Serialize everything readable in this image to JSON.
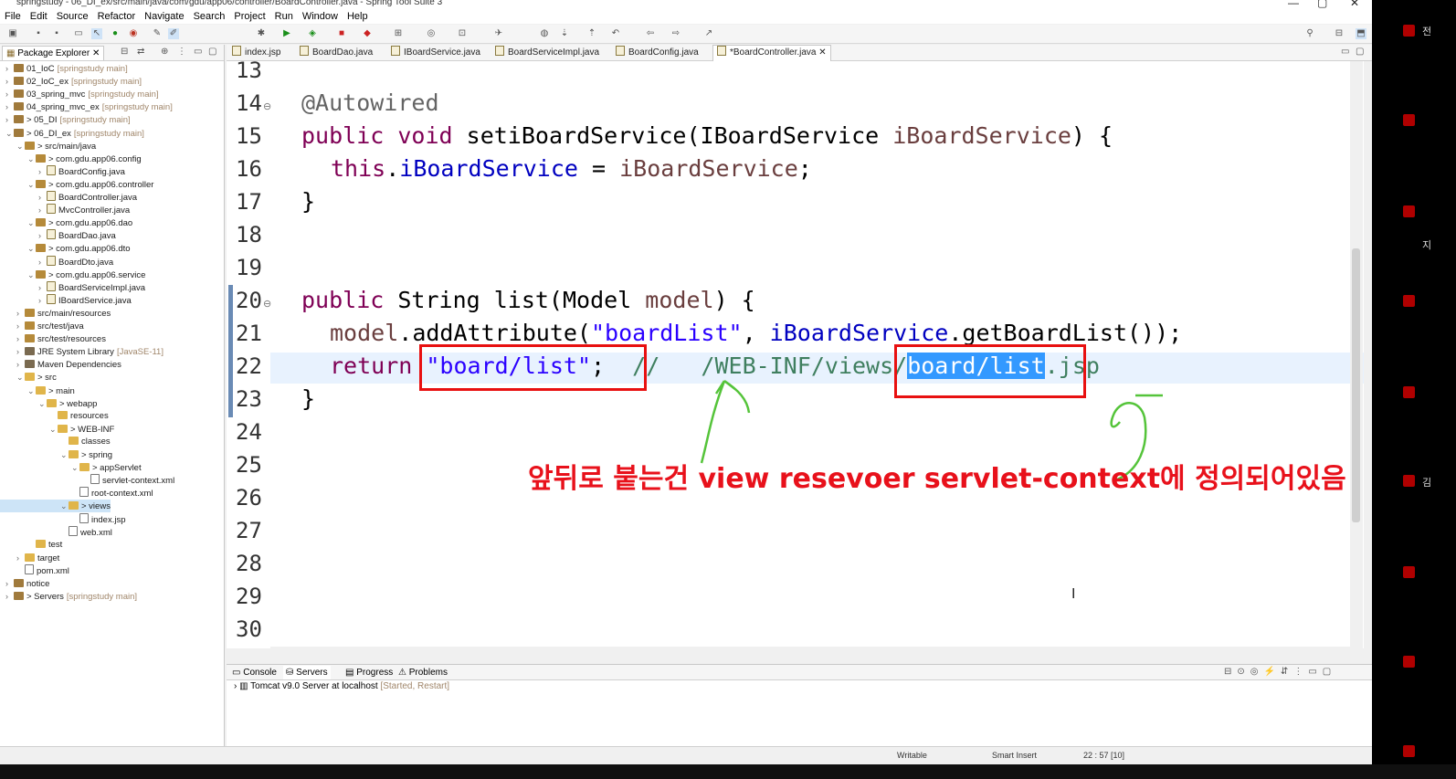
{
  "window": {
    "title": "springstudy - 06_DI_ex/src/main/java/com/gdu/app06/controller/BoardController.java - Spring Tool Suite 3",
    "controls": [
      "—",
      "▢",
      "✕"
    ]
  },
  "menu": [
    "File",
    "Edit",
    "Source",
    "Refactor",
    "Navigate",
    "Search",
    "Project",
    "Run",
    "Window",
    "Help"
  ],
  "explorer": {
    "tab_label": "Package Explorer",
    "items": [
      {
        "chev": "›",
        "label": "01_IoC",
        "deco": "[springstudy main]",
        "icon": "proj",
        "indent": 0
      },
      {
        "chev": "›",
        "label": "02_IoC_ex",
        "deco": "[springstudy main]",
        "icon": "proj",
        "indent": 0
      },
      {
        "chev": "›",
        "label": "03_spring_mvc",
        "deco": "[springstudy main]",
        "icon": "proj",
        "indent": 0
      },
      {
        "chev": "›",
        "label": "04_spring_mvc_ex",
        "deco": "[springstudy main]",
        "icon": "proj",
        "indent": 0
      },
      {
        "chev": "›",
        "label": "> 05_DI",
        "deco": "[springstudy main]",
        "icon": "proj",
        "indent": 0
      },
      {
        "chev": "⌄",
        "label": "> 06_DI_ex",
        "deco": "[springstudy main]",
        "icon": "proj",
        "indent": 0
      },
      {
        "chev": "⌄",
        "label": "> src/main/java",
        "deco": "",
        "icon": "pkg",
        "indent": 1
      },
      {
        "chev": "⌄",
        "label": "> com.gdu.app06.config",
        "deco": "",
        "icon": "pkg",
        "indent": 2
      },
      {
        "chev": "›",
        "label": "BoardConfig.java",
        "deco": "",
        "icon": "java",
        "indent": 3
      },
      {
        "chev": "⌄",
        "label": "> com.gdu.app06.controller",
        "deco": "",
        "icon": "pkg",
        "indent": 2
      },
      {
        "chev": "›",
        "label": "BoardController.java",
        "deco": "",
        "icon": "java",
        "indent": 3
      },
      {
        "chev": "›",
        "label": "MvcController.java",
        "deco": "",
        "icon": "java",
        "indent": 3
      },
      {
        "chev": "⌄",
        "label": "> com.gdu.app06.dao",
        "deco": "",
        "icon": "pkg",
        "indent": 2
      },
      {
        "chev": "›",
        "label": "BoardDao.java",
        "deco": "",
        "icon": "java",
        "indent": 3
      },
      {
        "chev": "⌄",
        "label": "> com.gdu.app06.dto",
        "deco": "",
        "icon": "pkg",
        "indent": 2
      },
      {
        "chev": "›",
        "label": "BoardDto.java",
        "deco": "",
        "icon": "java",
        "indent": 3
      },
      {
        "chev": "⌄",
        "label": "> com.gdu.app06.service",
        "deco": "",
        "icon": "pkg",
        "indent": 2
      },
      {
        "chev": "›",
        "label": "BoardServiceImpl.java",
        "deco": "",
        "icon": "java",
        "indent": 3
      },
      {
        "chev": "›",
        "label": "IBoardService.java",
        "deco": "",
        "icon": "java",
        "indent": 3
      },
      {
        "chev": "›",
        "label": "src/main/resources",
        "deco": "",
        "icon": "pkg",
        "indent": 1
      },
      {
        "chev": "›",
        "label": "src/test/java",
        "deco": "",
        "icon": "pkg",
        "indent": 1
      },
      {
        "chev": "›",
        "label": "src/test/resources",
        "deco": "",
        "icon": "pkg",
        "indent": 1
      },
      {
        "chev": "›",
        "label": "JRE System Library",
        "deco": "[JavaSE-11]",
        "icon": "lib",
        "indent": 1
      },
      {
        "chev": "›",
        "label": "Maven Dependencies",
        "deco": "",
        "icon": "lib",
        "indent": 1
      },
      {
        "chev": "⌄",
        "label": "> src",
        "deco": "",
        "icon": "folder",
        "indent": 1
      },
      {
        "chev": "⌄",
        "label": "> main",
        "deco": "",
        "icon": "folder",
        "indent": 2
      },
      {
        "chev": "⌄",
        "label": "> webapp",
        "deco": "",
        "icon": "folder",
        "indent": 3
      },
      {
        "chev": "",
        "label": "resources",
        "deco": "",
        "icon": "folder",
        "indent": 4
      },
      {
        "chev": "⌄",
        "label": "> WEB-INF",
        "deco": "",
        "icon": "folder",
        "indent": 4
      },
      {
        "chev": "",
        "label": "classes",
        "deco": "",
        "icon": "folder",
        "indent": 5
      },
      {
        "chev": "⌄",
        "label": "> spring",
        "deco": "",
        "icon": "folder",
        "indent": 5
      },
      {
        "chev": "⌄",
        "label": "> appServlet",
        "deco": "",
        "icon": "folder",
        "indent": 6
      },
      {
        "chev": "",
        "label": "servlet-context.xml",
        "deco": "",
        "icon": "xml",
        "indent": 7
      },
      {
        "chev": "",
        "label": "root-context.xml",
        "deco": "",
        "icon": "xml",
        "indent": 6
      },
      {
        "chev": "⌄",
        "label": "> views",
        "deco": "",
        "icon": "folder",
        "indent": 5,
        "selected": true
      },
      {
        "chev": "",
        "label": "index.jsp",
        "deco": "",
        "icon": "xml",
        "indent": 6
      },
      {
        "chev": "",
        "label": "web.xml",
        "deco": "",
        "icon": "xml",
        "indent": 5
      },
      {
        "chev": "",
        "label": "test",
        "deco": "",
        "icon": "folder",
        "indent": 2
      },
      {
        "chev": "›",
        "label": "target",
        "deco": "",
        "icon": "folder",
        "indent": 1
      },
      {
        "chev": "",
        "label": "pom.xml",
        "deco": "",
        "icon": "xml",
        "indent": 1
      },
      {
        "chev": "›",
        "label": "notice",
        "deco": "",
        "icon": "proj",
        "indent": 0
      },
      {
        "chev": "›",
        "label": "> Servers",
        "deco": "[springstudy main]",
        "icon": "proj",
        "indent": 0
      }
    ]
  },
  "editor_tabs": [
    {
      "label": "index.jsp"
    },
    {
      "label": "BoardDao.java"
    },
    {
      "label": "IBoardService.java"
    },
    {
      "label": "BoardServiceImpl.java"
    },
    {
      "label": "BoardConfig.java"
    },
    {
      "label": "*BoardController.java",
      "active": true,
      "close": "✕"
    }
  ],
  "code": {
    "line_numbers": [
      "13",
      "14",
      "15",
      "16",
      "17",
      "18",
      "19",
      "20",
      "21",
      "22",
      "23",
      "24",
      "25",
      "26",
      "27",
      "28",
      "29",
      "30"
    ],
    "fold_14": "⊖",
    "fold_20": "⊖",
    "l14": {
      "ann": "@Autowired"
    },
    "l15": {
      "kw1": "public",
      "kw2": "void",
      "name": "setiBoardService(IBoardService ",
      "param": "iBoardService",
      "tail": ") {"
    },
    "l16": {
      "kw": "this",
      "dot": ".",
      "field": "iBoardService",
      "eq": " = ",
      "param": "iBoardService",
      "semi": ";"
    },
    "l17": {
      "brace": "}"
    },
    "l20": {
      "kw": "public",
      "rest": " String list(Model ",
      "param": "model",
      "tail": ") {"
    },
    "l21": {
      "param": "model",
      "mid": ".addAttribute(",
      "str": "\"boardList\"",
      "comma": ", ",
      "field": "iBoardService",
      "tail": ".getBoardList());"
    },
    "l22": {
      "kw": "return",
      "str": "\"board/list\"",
      "semi": ";",
      "cmt1": "//   /WEB-INF/views/",
      "sel": "board/list",
      "cmt2": ".jsp"
    },
    "l23": {
      "brace": "}"
    }
  },
  "annotation": {
    "text": "앞뒤로 붙는건 view resevoer servlet-context에 정의되어있음",
    "color": "#e8111b"
  },
  "bottom_panel": {
    "tabs": [
      "Console",
      "Servers",
      "Progress",
      "Problems"
    ],
    "server": "Tomcat v9.0 Server at localhost",
    "server_state": "[Started, Restart]"
  },
  "status": {
    "writable": "Writable",
    "insert": "Smart Insert",
    "position": "22 : 57 [10]"
  },
  "right_panel": {
    "labels": [
      "전",
      "지",
      "김"
    ]
  }
}
